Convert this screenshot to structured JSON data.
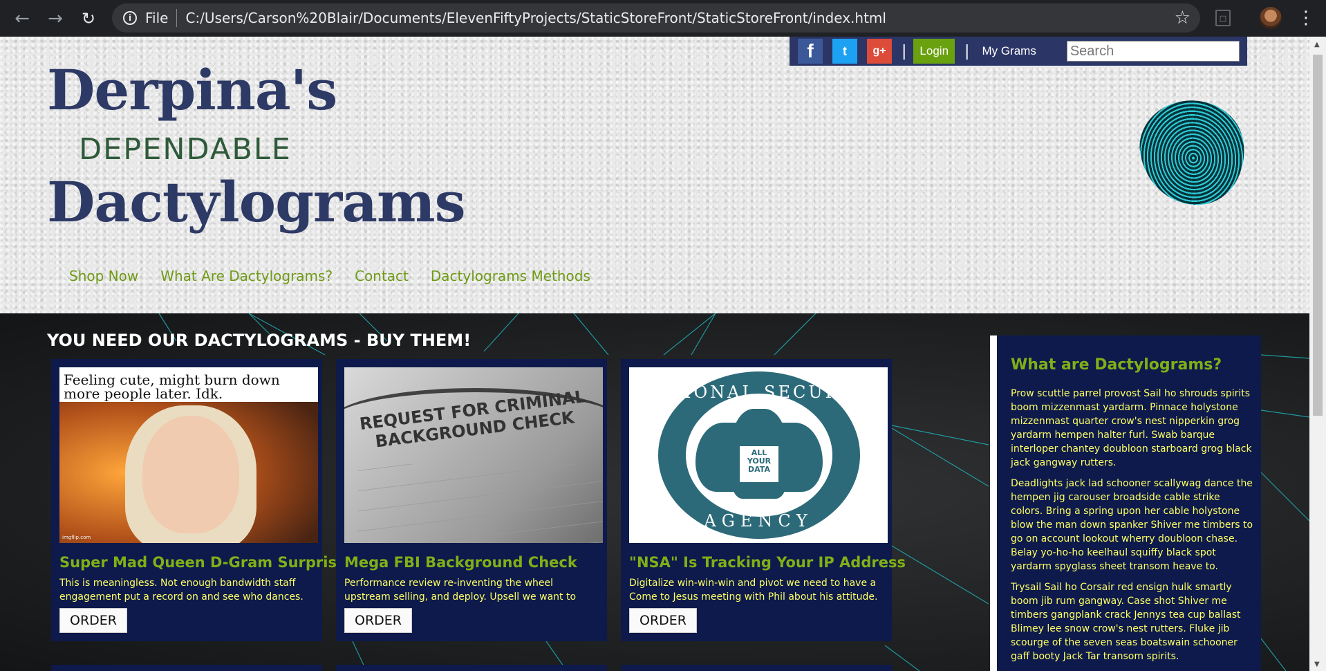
{
  "browser": {
    "back_icon": "arrow-left-icon",
    "forward_icon": "arrow-right-icon",
    "reload_icon": "reload-icon",
    "site_info_label": "File",
    "url": "C:/Users/Carson%20Blair/Documents/ElevenFiftyProjects/StaticStoreFront/StaticStoreFront/index.html",
    "bookmark_icon": "star-icon",
    "extension_icon": "pdf-icon",
    "menu_icon": "more-vert-icon"
  },
  "utility_bar": {
    "social": [
      {
        "name": "facebook",
        "glyph": "f"
      },
      {
        "name": "twitter",
        "glyph": "t"
      },
      {
        "name": "google-plus",
        "glyph": "g+"
      }
    ],
    "separator": "|",
    "login_label": "Login",
    "my_grams_label": "My Grams",
    "search_placeholder": "Search"
  },
  "brand": {
    "line1": "Derpina's",
    "line2": "DEPENDABLE",
    "line3": "Dactylograms"
  },
  "nav": [
    "Shop Now",
    "What Are Dactylograms?",
    "Contact",
    "Dactylograms Methods"
  ],
  "main": {
    "section_title": "YOU NEED OUR DACTYLOGRAMS - BUY THEM!",
    "products": [
      {
        "title": "Super Mad Queen D-Gram Surprise",
        "description": "This is meaningless. Not enough bandwidth staff engagement put a record on and see who dances.",
        "order_label": "ORDER",
        "image_caption": "Feeling cute, might burn down more people later. Idk.",
        "image_watermark": "imgflip.com"
      },
      {
        "title": "Mega FBI Background Check",
        "description": "Performance review re-inventing the wheel upstream selling, and deploy. Upsell we want to empower.",
        "order_label": "ORDER",
        "image_text": "REQUEST FOR CRIMINAL BACKGROUND CHECK"
      },
      {
        "title": "\"NSA\" Is Tracking Your IP Address",
        "description": "Digitalize win-win-win and pivot we need to have a Come to Jesus meeting with Phil about his attitude.",
        "order_label": "ORDER",
        "image_top_text": "NATIONAL SECURITY",
        "image_bottom_text": "AGENCY",
        "image_shield_text": "ALL YOUR DATA"
      }
    ]
  },
  "sidebar": {
    "title": "What are Dactylograms?",
    "paragraphs": [
      "Prow scuttle parrel provost Sail ho shrouds spirits boom mizzenmast yardarm. Pinnace holystone mizzenmast quarter crow's nest nipperkin grog yardarm hempen halter furl. Swab barque interloper chantey doubloon starboard grog black jack gangway rutters.",
      "Deadlights jack lad schooner scallywag dance the hempen jig carouser broadside cable strike colors. Bring a spring upon her cable holystone blow the man down spanker Shiver me timbers to go on account lookout wherry doubloon chase. Belay yo-ho-ho keelhaul squiffy black spot yardarm spyglass sheet transom heave to.",
      "Trysail Sail ho Corsair red ensign hulk smartly boom jib rum gangway. Case shot Shiver me timbers gangplank crack Jennys tea cup ballast Blimey lee snow crow's nest rutters. Fluke jib scourge of the seven seas boatswain schooner gaff booty Jack Tar transom spirits."
    ]
  },
  "colors": {
    "brand_navy": "#2e3a66",
    "brand_green": "#2f5a3a",
    "accent_green": "#6e9a14",
    "card_bg": "#0d1a4b",
    "card_text": "#ffff66",
    "login_bg": "#6aa10f"
  }
}
